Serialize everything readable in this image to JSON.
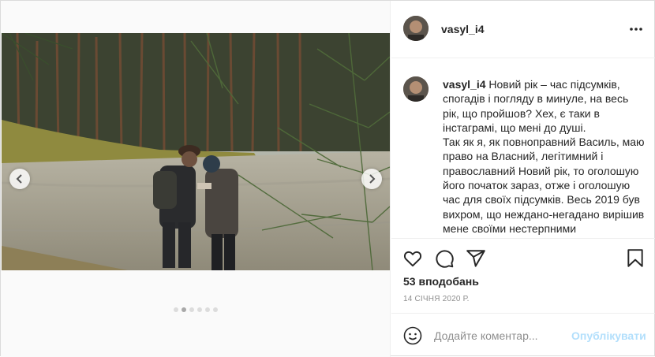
{
  "post": {
    "username": "vasyl_i4",
    "caption_user": "vasyl_i4",
    "caption_body": " Новий рік – час підсумків, спогадів і погляду в минуле, на весь рік, що пройшов? Хех, є таки в інстаграмі, що мені до душі.\nТак як я, як повноправний Василь, маю право на Власний, легітимний і православний Новий рік, то оголошую його початок зараз, отже і оголошую час для своїх підсумків. Весь 2019 був вихром, що неждано-негадано вирішив мене своїми нестерпними характеристиками",
    "likes": "53 вподобань",
    "date": "14 СІЧНЯ 2020 Р.",
    "carousel": {
      "slides": 6,
      "active_index": 1
    }
  },
  "comment": {
    "placeholder": "Додайте коментар...",
    "publish_label": "Опублікувати"
  },
  "icons": {
    "more": "more-options-icon",
    "like": "heart-icon",
    "comment": "comment-icon",
    "share": "share-icon",
    "save": "bookmark-icon",
    "emoji": "emoji-icon",
    "prev": "chevron-left-icon",
    "next": "chevron-right-icon"
  },
  "colors": {
    "border": "#dbdbdb",
    "text": "#262626",
    "muted": "#8e8e8e",
    "publish_disabled": "#b2dffc"
  }
}
